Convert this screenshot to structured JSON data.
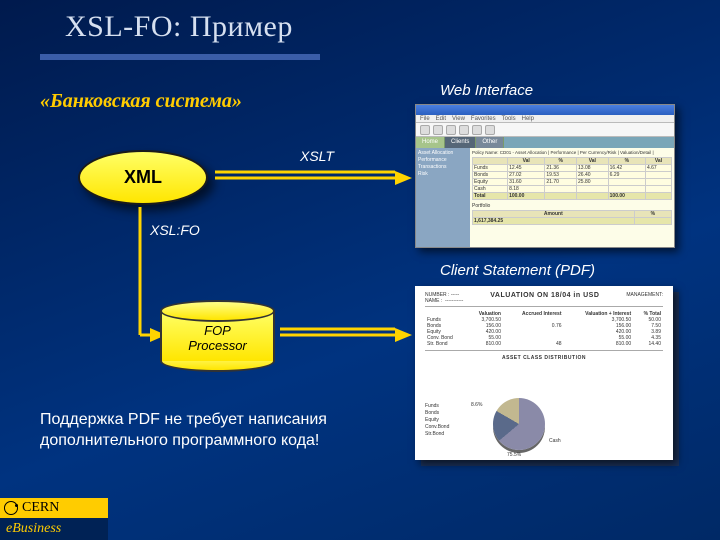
{
  "title": "XSL-FO: Пример",
  "subtitle": "«Банковская система»",
  "nodes": {
    "xml": "XML",
    "fop_line1": "FOP",
    "fop_line2": "Processor"
  },
  "labels": {
    "xslt": "XSLT",
    "xslfo": "XSL:FO",
    "web": "Web Interface",
    "client": "Client Statement (PDF)"
  },
  "footer_line1": "Поддержка PDF не требует написания",
  "footer_line2": "дополнительного программного кода!",
  "cern": {
    "top": "CERN",
    "bottom_e": "e",
    "bottom_rest": " Business"
  },
  "web_mock": {
    "menu": [
      "File",
      "Edit",
      "View",
      "Favorites",
      "Tools",
      "Help"
    ],
    "tabs": [
      "Home",
      "Clients",
      "Other"
    ],
    "side": [
      "Asset Allocation",
      "Performance",
      "Transactions",
      "Risk"
    ],
    "caption": "Policy Name: CD01 - Asset Allocation | Performance | Per Currency/Risk | Valuation/Detail |",
    "headers": [
      "",
      "Val",
      "%",
      "Val",
      "%",
      "Val",
      "%"
    ],
    "rows": [
      [
        "Funds",
        "12.45",
        "21.36",
        "13.08",
        "16.42",
        "4.67"
      ],
      [
        "Bonds",
        "27.02",
        "19.53",
        "26.40",
        "6.29",
        ""
      ],
      [
        "Equity",
        "31.60",
        "21.70",
        "25.80",
        "",
        ""
      ],
      [
        "Cash",
        "8.18",
        "",
        "",
        "",
        ""
      ]
    ],
    "sum": [
      "Total",
      "100.00",
      "",
      "",
      "100.00",
      ""
    ],
    "portfolio": "Portfolio",
    "amount_label": "Amount",
    "amount_val": "1,617,384.25"
  },
  "pdf_mock": {
    "left_head1": "NUMBER",
    "left_head2": "NAME",
    "title": "VALUATION  ON 18/04 in  USD",
    "right_head": "MANAGEMENT:",
    "cols": [
      "",
      "Valuation",
      "Accrued Interest",
      "Valuation + Interest",
      "% Total"
    ],
    "rows": [
      [
        "Funds",
        "3,700.50",
        "",
        "3,700.50",
        "50.00"
      ],
      [
        "Bonds",
        "156.00",
        "0.76",
        "156.00",
        "7.50"
      ],
      [
        "Equity",
        "420.00",
        "",
        "420.00",
        "3.89"
      ],
      [
        "Conv. Bond",
        "55.00",
        "",
        "55.00",
        "4.35"
      ],
      [
        "Str. Bond",
        "810.00",
        "48",
        "810.00",
        "14.40"
      ]
    ],
    "section": "ASSET CLASS DISTRIBUTION",
    "legend": [
      "Funds",
      "Bonds",
      "Equity",
      "Conv.Bond",
      "Str.Bond"
    ],
    "pie_labels": [
      "8.6%",
      "Cash",
      "75.5%"
    ]
  }
}
